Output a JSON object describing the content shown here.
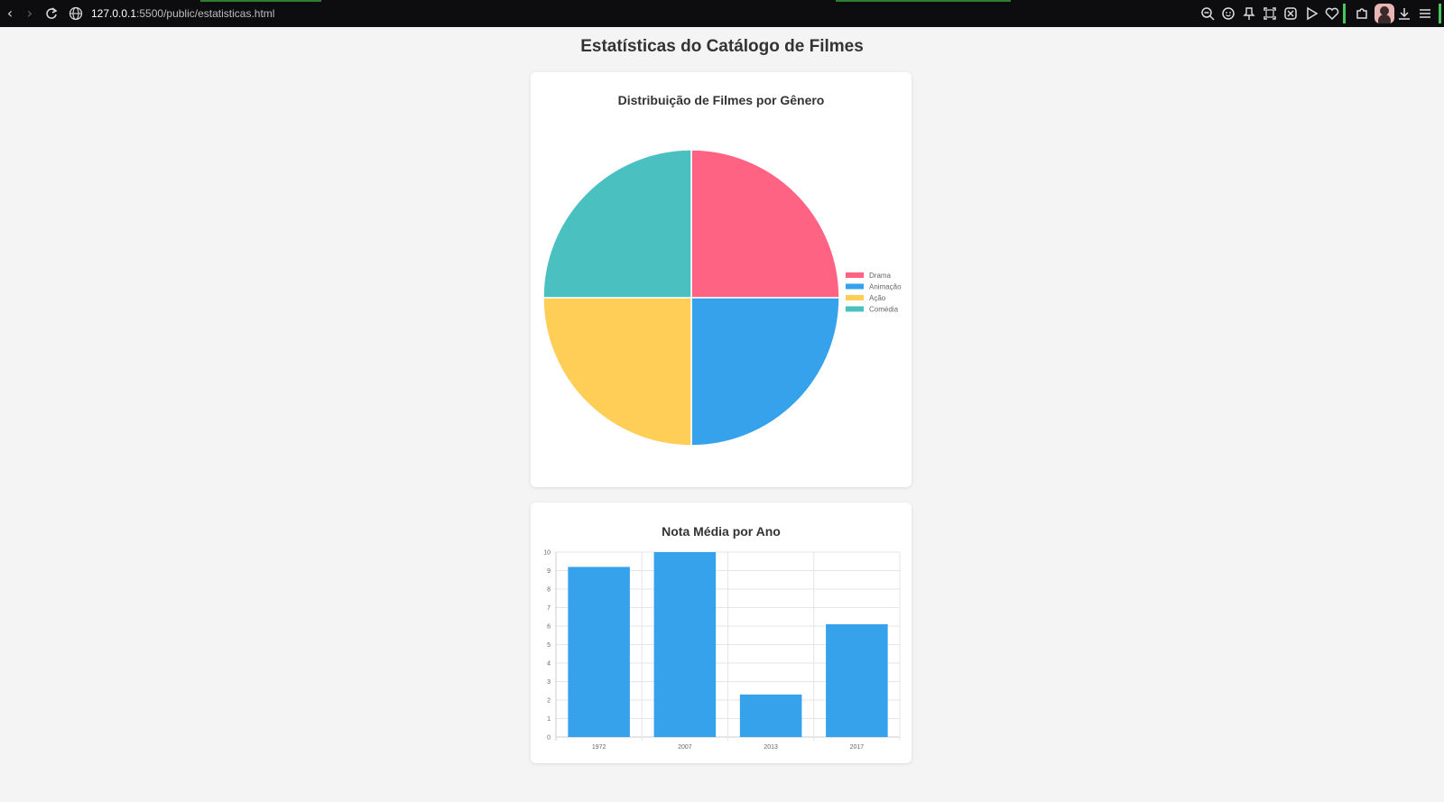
{
  "browser": {
    "url_host": "127.0.0.1",
    "url_rest": ":5500/public/estatisticas.html"
  },
  "page": {
    "title": "Estatísticas do Catálogo de Filmes"
  },
  "colors": {
    "drama": "#ff6384",
    "animacao": "#36a2eb",
    "acao": "#ffce56",
    "comedia": "#4bc0c0",
    "bar": "#36a2eb",
    "grid": "#e6e6e6",
    "axis": "#cccccc"
  },
  "chart_data": [
    {
      "type": "pie",
      "title": "Distribuição de Filmes por Gênero",
      "legend_position": "right",
      "series": [
        {
          "name": "Drama",
          "value": 1,
          "color": "#ff6384"
        },
        {
          "name": "Animação",
          "value": 1,
          "color": "#36a2eb"
        },
        {
          "name": "Ação",
          "value": 1,
          "color": "#ffce56"
        },
        {
          "name": "Comédia",
          "value": 1,
          "color": "#4bc0c0"
        }
      ]
    },
    {
      "type": "bar",
      "title": "Nota Média por Ano",
      "categories": [
        "1972",
        "2007",
        "2013",
        "2017"
      ],
      "values": [
        9.2,
        10,
        2.3,
        6.1
      ],
      "ylim": [
        0,
        10
      ],
      "yticks": [
        "0",
        "1",
        "2",
        "3",
        "4",
        "5",
        "6",
        "7",
        "8",
        "9",
        "10"
      ],
      "grid": true,
      "color": "#36a2eb"
    }
  ]
}
